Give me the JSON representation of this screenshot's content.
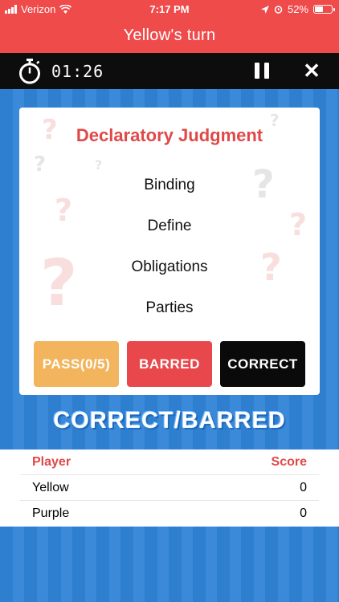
{
  "status_bar": {
    "carrier": "Verizon",
    "time": "7:17 PM",
    "battery": "52%",
    "battery_level": 0.52
  },
  "header": {
    "title": "Yellow's turn"
  },
  "timer": {
    "value": "01:26"
  },
  "card": {
    "title": "Declaratory Judgment",
    "words": [
      "Binding",
      "Define",
      "Obligations",
      "Parties"
    ],
    "buttons": {
      "pass": "PASS(0/5)",
      "barred": "BARRED",
      "correct": "CORRECT"
    }
  },
  "mode": {
    "label": "CORRECT/BARRED"
  },
  "scores": {
    "headers": {
      "player": "Player",
      "score": "Score"
    },
    "rows": [
      {
        "player": "Yellow",
        "score": "0"
      },
      {
        "player": "Purple",
        "score": "0"
      }
    ]
  },
  "colors": {
    "accent_red": "#ef4b4b",
    "pass": "#f2b55e",
    "barred": "#e8484b",
    "correct": "#0a0a0a",
    "board_blue": "#2f7fd1"
  }
}
